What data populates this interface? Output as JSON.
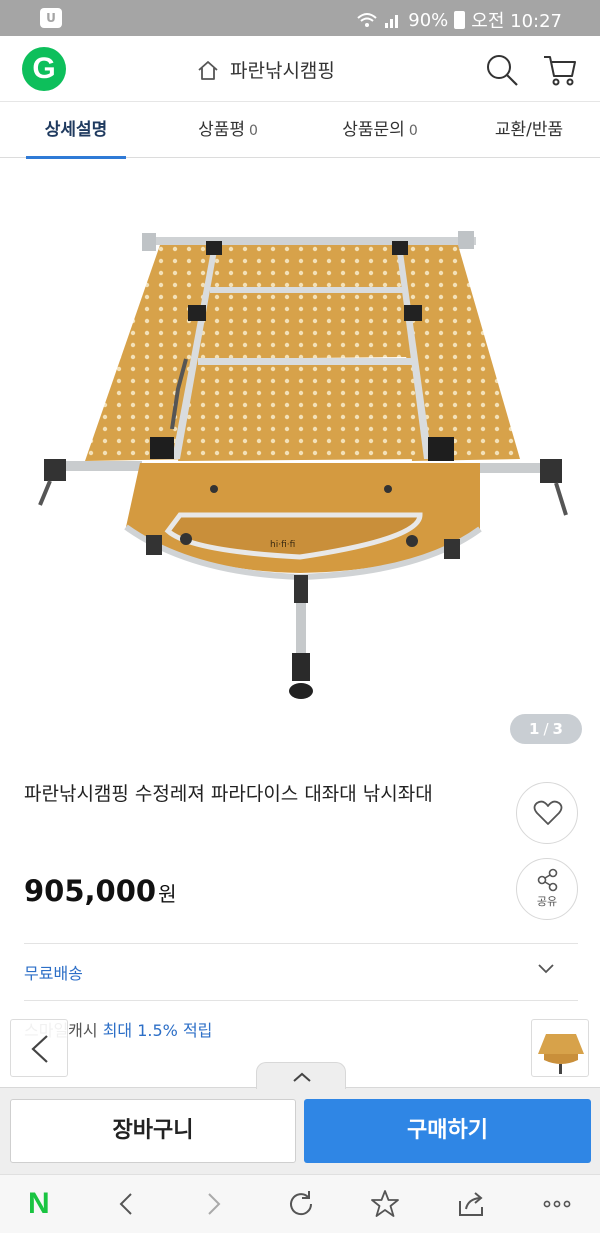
{
  "status_bar": {
    "app_icon_label": "U",
    "battery": "90%",
    "time": "오전 10:27"
  },
  "header": {
    "logo_label": "G",
    "shop_name": "파란낚시캠핑",
    "icons": [
      "home-icon",
      "search-icon",
      "cart-icon"
    ]
  },
  "tabs": [
    {
      "label": "상세설명",
      "count": "",
      "active": true
    },
    {
      "label": "상품평",
      "count": "0",
      "active": false
    },
    {
      "label": "상품문의",
      "count": "0",
      "active": false
    },
    {
      "label": "교환/반품",
      "count": "",
      "active": false
    }
  ],
  "gallery": {
    "current": "1",
    "separator": "/",
    "total": "3"
  },
  "product": {
    "title": "파란낚시캠핑 수정레져 파라다이스 대좌대 낚시좌대",
    "price": "905,000",
    "currency": "원",
    "share_label": "공유"
  },
  "shipping": {
    "label": "무료배송"
  },
  "cashback": {
    "prefix": "스마일캐시",
    "highlight": "최대 1.5% 적립"
  },
  "actions": {
    "cart_label": "장바구니",
    "buy_label": "구매하기"
  },
  "browser_toolbar": {
    "logo_label": "N",
    "icons": [
      "back-icon",
      "forward-icon",
      "refresh-icon",
      "bookmark-star-icon",
      "share-icon",
      "more-icon"
    ]
  },
  "colors": {
    "accent_blue": "#2f86e5",
    "brand_green": "#0dbf5b",
    "link_blue": "#2d6fc7"
  }
}
